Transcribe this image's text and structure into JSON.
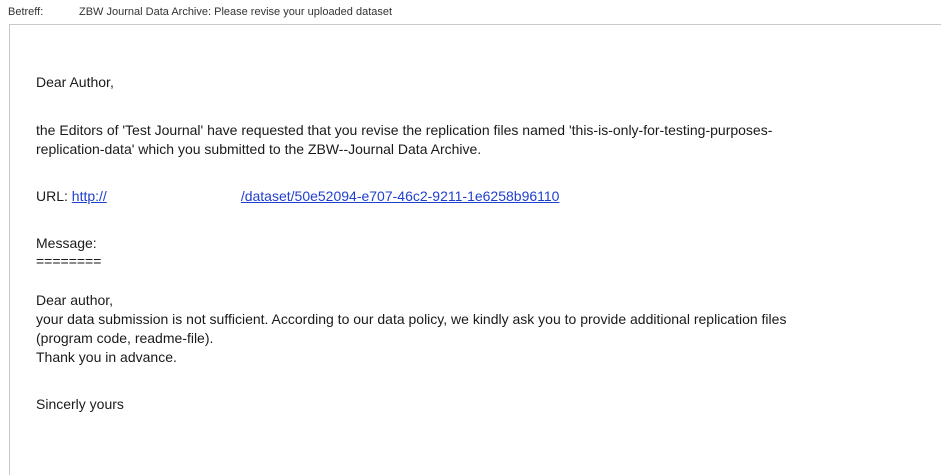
{
  "header": {
    "label": "Betreff:",
    "subject": "ZBW Journal Data Archive: Please revise your uploaded dataset"
  },
  "message": {
    "greeting": "Dear Author,",
    "intro_line1": "the Editors of 'Test Journal' have requested that you revise the replication files named 'this-is-only-for-testing-purposes-",
    "intro_line2": "replication-data' which you submitted to the ZBW--Journal Data Archive.",
    "url_label": "URL: ",
    "url_start": "http://",
    "url_end": "/dataset/50e52094-e707-46c2-9211-1e6258b96110",
    "message_label": "Message:",
    "separator": "========",
    "inner_greeting": "Dear author,",
    "body_line1": "your data submission is not sufficient. According to our data policy, we kindly ask you to provide additional replication files",
    "body_line2": "(program code, readme-file).",
    "body_line3": "Thank you in advance.",
    "closing": "Sincerly yours"
  },
  "colors": {
    "link": "#1f3fd0",
    "border": "#c9c9c9"
  }
}
